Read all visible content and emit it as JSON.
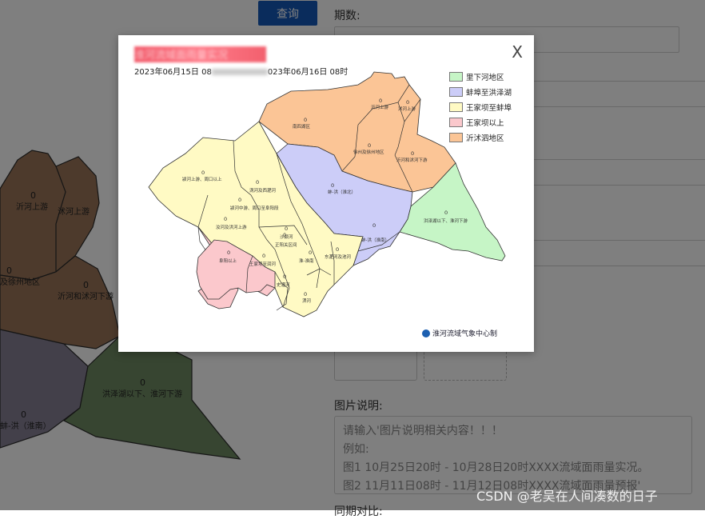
{
  "page": {
    "query_button": "查询",
    "period_label": "期数:",
    "image_caption_label": "图片说明:",
    "caption_lines": [
      "请输入'图片说明相关内容！！！",
      "例如:",
      "图1  10月25日20时 - 10月28日20时XXXX流域面雨量实况。",
      "图2  11月11日08时 - 11月12日08时XXXX流域面雨量预报'"
    ],
    "partial_label": "同期对比:",
    "watermark": "CSDN @老吴在人间凑数的日子"
  },
  "background_map": {
    "regions": [
      {
        "name": "沂河上游",
        "value": "0"
      },
      {
        "name": "沭河上游",
        "value": ""
      },
      {
        "name": "及徐州地区",
        "value": "0"
      },
      {
        "name": "沂河和沭河下游",
        "value": "0"
      },
      {
        "name": "洪泽湖以下、淮河下游",
        "value": "0"
      },
      {
        "name": "蚌-洪（淮南）",
        "value": "0"
      }
    ]
  },
  "modal": {
    "title": "淮河流域面雨量实况",
    "subtitle_start": "2023年06月15日 08",
    "subtitle_end": "023年06月16日 08时",
    "close_label": "X",
    "legend": [
      {
        "label": "里下河地区",
        "color": "#c6f5c6"
      },
      {
        "label": "蚌埠至洪泽湖",
        "color": "#cccdf8"
      },
      {
        "label": "王家坝至蚌埠",
        "color": "#fffac4"
      },
      {
        "label": "王家坝以上",
        "color": "#fbc8cc"
      },
      {
        "label": "沂沭泗地区",
        "color": "#fbc596"
      }
    ],
    "credit": "淮河流域气象中心制",
    "regions": [
      {
        "name": "南四湖区",
        "value": "0"
      },
      {
        "name": "沂河上游",
        "value": "0"
      },
      {
        "name": "沭河上游",
        "value": "0"
      },
      {
        "name": "徐州及徐州地区",
        "value": "0"
      },
      {
        "name": "沂河和沭河下游",
        "value": "0"
      },
      {
        "name": "颍河上游、周口以上",
        "value": "0"
      },
      {
        "name": "涡河及西淝河",
        "value": "0"
      },
      {
        "name": "蚌-洪（淮北）",
        "value": "0"
      },
      {
        "name": "洪泽湖以下、淮河下游",
        "value": "0"
      },
      {
        "name": "颍河中游、周口至阜阳段",
        "value": "0"
      },
      {
        "name": "汝河及洪河上游",
        "value": "0"
      },
      {
        "name": "阜阳以上",
        "value": "0"
      },
      {
        "name": "王家坝至润河",
        "value": "0"
      },
      {
        "name": "淮-淮南",
        "value": "0"
      },
      {
        "name": "史灌河",
        "value": "0"
      },
      {
        "name": "淠河",
        "value": "0"
      },
      {
        "name": "沙颍河",
        "value": "0"
      },
      {
        "name": "正阳关区间",
        "value": "0"
      },
      {
        "name": "东淝河及池河",
        "value": "0"
      },
      {
        "name": "蚌-洪（淮南）",
        "value": "0"
      }
    ]
  }
}
